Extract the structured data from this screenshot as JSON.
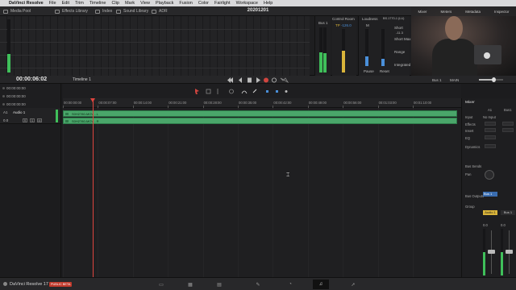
{
  "menubar": {
    "apple": "",
    "items": [
      "DaVinci Resolve",
      "File",
      "Edit",
      "Trim",
      "Timeline",
      "Clip",
      "Mark",
      "View",
      "Playback",
      "Fusion",
      "Color",
      "Fairlight",
      "Workspace",
      "Help"
    ]
  },
  "topbar": {
    "media_pool": "Media Pool",
    "effects_library": "Effects Library",
    "index": "Index",
    "sound_library": "Sound Library",
    "adr": "ADR",
    "project_title": "20201201"
  },
  "inspector_tabs": {
    "mixer": "Mixer",
    "meters": "Meters",
    "metadata": "Metadata",
    "inspector": "Inspector"
  },
  "meters": {
    "bus1": "Bus 1",
    "control_room": "Control Room",
    "tp_label": "TP",
    "tp_value": "-126.0",
    "m_label": "M",
    "loudness": "Loudness",
    "loudness_std": "BS.1770-1 (LU)",
    "short_label": "Short",
    "short_value": "-11.3",
    "short_max_label": "Short Max",
    "range_label": "Range",
    "integrated_label": "Integrated",
    "pause": "Pause",
    "reset": "Reset",
    "bus1_level": 0.45,
    "control_room_level": 0.5,
    "loudness_level": 0.25
  },
  "timeline": {
    "timecode": "00:00:06:02",
    "name": "Timeline 1",
    "output_bus": "Bus 1",
    "output_mode": "MAIN",
    "tc_rows": [
      "00:00:00:00",
      "00:00:00:00",
      "00:00:00:00"
    ],
    "ruler": [
      "00:00:00:00",
      "00:00:07:00",
      "00:00:14:00",
      "00:00:21:00",
      "00:00:28:00",
      "00:00:35:00",
      "00:00:42:00",
      "00:00:49:00",
      "00:00:56:00",
      "00:01:03:00",
      "00:01:10:00"
    ],
    "track": {
      "id": "A1",
      "name": "Audio 1",
      "level": "0.0",
      "buttons": [
        "R",
        "S",
        "M"
      ]
    },
    "clips": [
      {
        "label": "S0H2780-MOV - L"
      },
      {
        "label": "S0H2780-MOV - R"
      }
    ]
  },
  "mixer": {
    "title": "Mixer",
    "col_a1": "A1",
    "col_bus1": "Bus1",
    "input": "Input",
    "no_input": "No Input",
    "effects": "Effects",
    "insert": "Insert",
    "eq": "EQ",
    "dynamics": "Dynamics",
    "bus_sends": "Bus Sends",
    "pan": "Pan",
    "bus_outputs": "Bus Outputs",
    "bus_output_value": "Bus 1",
    "group": "Group",
    "audio1": "Audio 1",
    "bus1": "Bus 1",
    "level_a1": "0.0",
    "level_bus1": "0.0",
    "fader_a1": 0.55,
    "fader_bus1": 0.55
  },
  "bottombar": {
    "brand": "DaVinci Resolve 17",
    "beta": "PUBLIC BETA",
    "pages": [
      "media",
      "cut",
      "edit",
      "fusion",
      "color",
      "fairlight",
      "deliver"
    ],
    "active_page": "fairlight"
  },
  "colors": {
    "clip_green": "#4aa66a",
    "playhead_red": "#e0453f",
    "meter_green": "#3fbf5a",
    "meter_yellow": "#d9b43a",
    "meter_blue": "#4a8fd9"
  }
}
